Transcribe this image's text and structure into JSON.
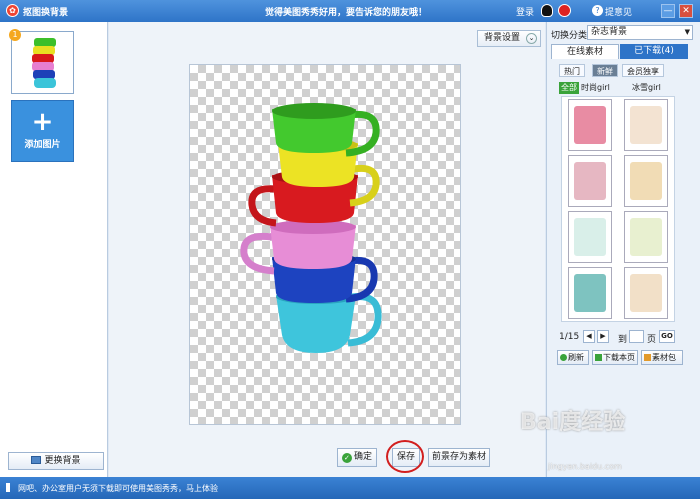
{
  "titlebar": {
    "app_title": "抠图换背景",
    "promo": "觉得美图秀秀好用，要告诉您的朋友哦！",
    "login": "登录",
    "feedback": "提意见",
    "min_glyph": "—",
    "close_glyph": "✕"
  },
  "left": {
    "add_label": "添加图片",
    "change_bg": "更换背景",
    "thumb_badge": "1"
  },
  "center": {
    "bg_settings": "背景设置",
    "ok": "确定",
    "save": "保存",
    "save_as": "前景存为素材"
  },
  "right": {
    "category_label": "切换分类",
    "category_value": "杂志背景",
    "tabs": [
      "在线素材",
      "已下载(4)"
    ],
    "filters": [
      "热门",
      "新鲜",
      "会员独享"
    ],
    "subfilters": [
      "全部",
      "时尚girl",
      "冰雪girl"
    ],
    "pager": {
      "page_text": "1/15",
      "go_to": "到",
      "page_suffix": "页",
      "go": "GO"
    },
    "buttons": [
      "刷新",
      "下载本页",
      "素材包"
    ],
    "tile_colors": [
      "#e88ca3",
      "#f3e3d2",
      "#e6b7c2",
      "#f1dcb5",
      "#d9efe9",
      "#e8f0d0",
      "#7ec3c0",
      "#f2e0c8"
    ]
  },
  "status": {
    "text": "网吧、办公室用户无须下载即可使用美图秀秀，马上体验"
  },
  "watermark": {
    "main": "Bai度经验",
    "sub": "jingyan.baidu.com"
  }
}
